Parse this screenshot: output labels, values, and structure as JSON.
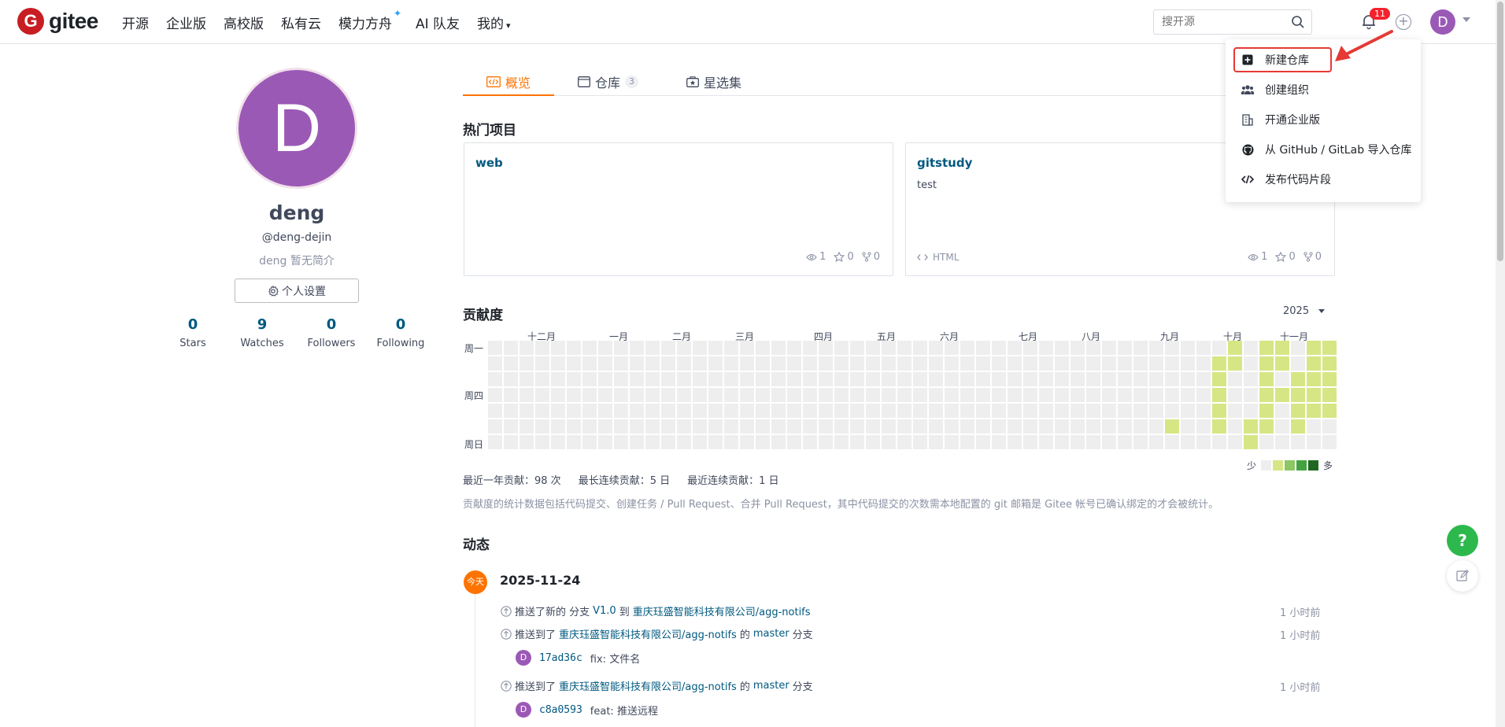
{
  "header": {
    "logo_text": "gitee",
    "logo_mark": "G",
    "nav": [
      "开源",
      "企业版",
      "高校版",
      "私有云",
      "模力方舟",
      "AI 队友",
      "我的"
    ],
    "search_placeholder": "搜开源",
    "notification_count": "11",
    "avatar_letter": "D"
  },
  "dropdown": {
    "items": [
      "新建仓库",
      "创建组织",
      "开通企业版",
      "从 GitHub / GitLab 导入仓库",
      "发布代码片段"
    ],
    "highlight_color": "#e53935"
  },
  "profile": {
    "avatar_letter": "D",
    "avatar_color": "#9b59b6",
    "name": "deng",
    "login": "@deng-dejin",
    "bio": "deng 暂无简介",
    "settings_label": "个人设置",
    "stats": [
      {
        "num": "0",
        "label": "Stars"
      },
      {
        "num": "9",
        "label": "Watches"
      },
      {
        "num": "0",
        "label": "Followers"
      },
      {
        "num": "0",
        "label": "Following"
      }
    ]
  },
  "tabs": [
    {
      "label": "概览",
      "active": true
    },
    {
      "label": "仓库",
      "count": "3"
    },
    {
      "label": "星选集"
    }
  ],
  "hot_projects": {
    "title": "热门项目",
    "cards": [
      {
        "name": "web",
        "desc": "",
        "lang": "",
        "views": "1",
        "stars": "0",
        "forks": "0"
      },
      {
        "name": "gitstudy",
        "desc": "test",
        "lang": "HTML",
        "views": "1",
        "stars": "0",
        "forks": "0"
      }
    ]
  },
  "contribution": {
    "title": "贡献度",
    "year": "2025",
    "months": [
      "十二月",
      "一月",
      "二月",
      "三月",
      "四月",
      "五月",
      "六月",
      "七月",
      "八月",
      "九月",
      "十月",
      "十一月"
    ],
    "weekdays": [
      "周一",
      "周四",
      "周日"
    ],
    "legend_less": "少",
    "legend_more": "多",
    "colors": [
      "#eeeeee",
      "#d6e685",
      "#8cc665",
      "#44a340",
      "#1e6823"
    ],
    "summary": [
      "最近一年贡献：98 次",
      "最长连续贡献：5 日",
      "最近连续贡献：1 日"
    ],
    "note": "贡献度的统计数据包括代码提交、创建任务 / Pull Request、合并 Pull Request，其中代码提交的次数需本地配置的 git 邮箱是 Gitee 帐号已确认绑定的才会被统计。"
  },
  "activity": {
    "title": "动态",
    "today_label": "今天",
    "date": "2025-11-24",
    "entries": [
      {
        "prefix": "推送了新的 分支",
        "branch": "V1.0",
        "mid": "到",
        "repo": "重庆珏盛智能科技有限公司/agg-notifs",
        "suffix": "",
        "time": "1 小时前"
      },
      {
        "prefix": "推送到了",
        "repo": "重庆珏盛智能科技有限公司/agg-notifs",
        "mid": "的",
        "branch": "master",
        "suffix": "分支",
        "time": "1 小时前",
        "sha": "17ad36c",
        "msg": "fix: 文件名"
      },
      {
        "prefix": "推送到了",
        "repo": "重庆珏盛智能科技有限公司/agg-notifs",
        "mid": "的",
        "branch": "master",
        "suffix": "分支",
        "time": "1 小时前",
        "sha": "c8a0593",
        "msg": "feat: 推送远程"
      }
    ]
  }
}
